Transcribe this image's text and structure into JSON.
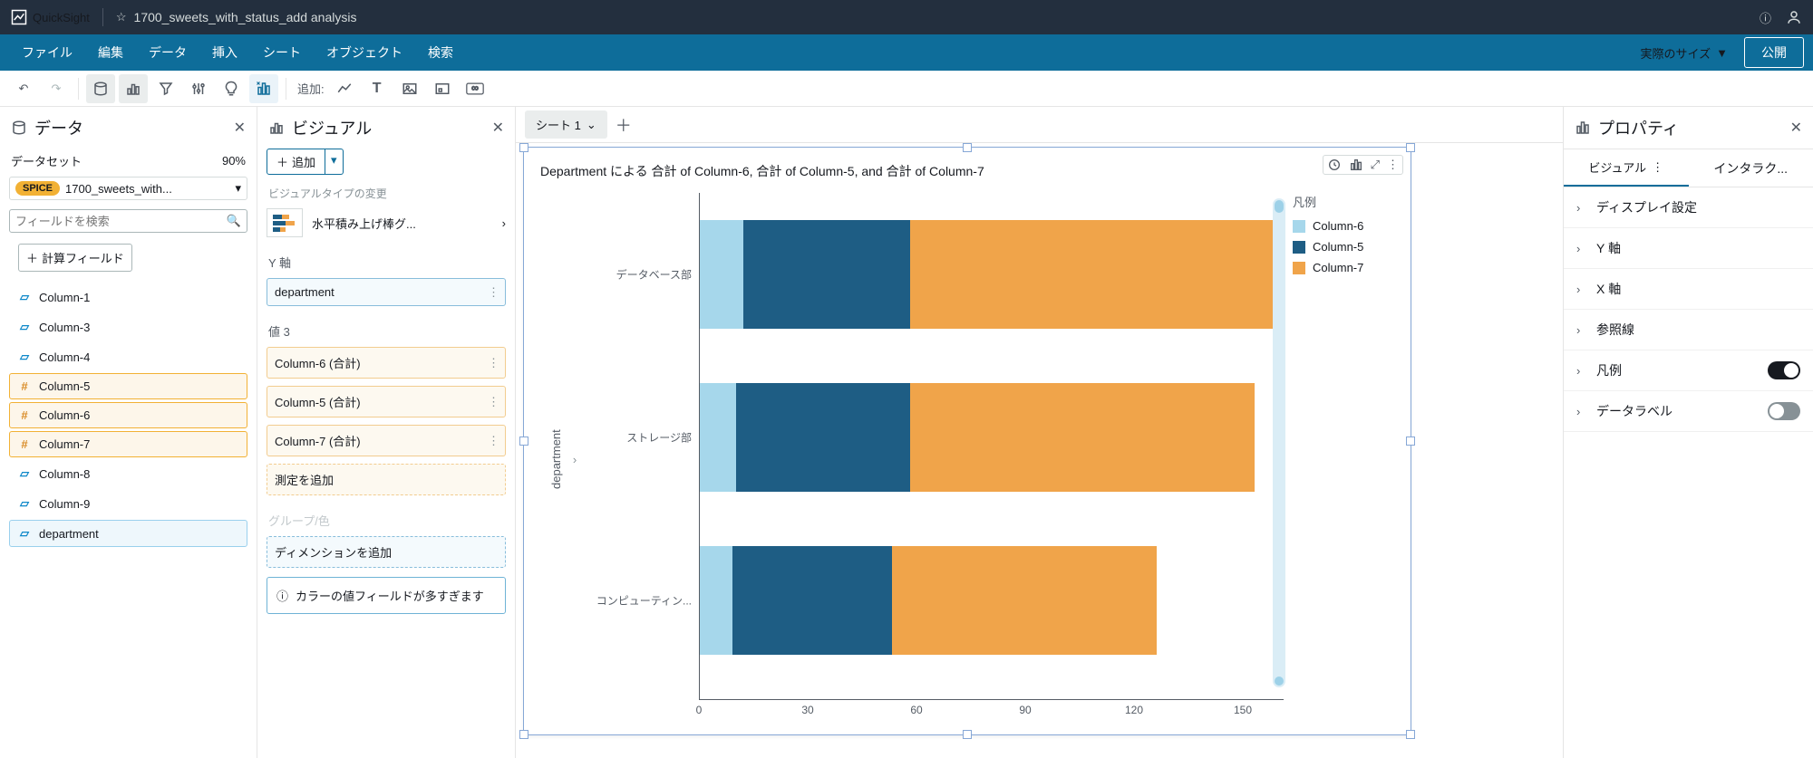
{
  "app": {
    "name": "QuickSight"
  },
  "analysis": {
    "title": "1700_sweets_with_status_add analysis"
  },
  "menubar": {
    "items": [
      "ファイル",
      "編集",
      "データ",
      "挿入",
      "シート",
      "オブジェクト",
      "検索"
    ],
    "size_label": "実際のサイズ",
    "publish": "公開"
  },
  "toolbar": {
    "add_label": "追加:"
  },
  "data_panel": {
    "title": "データ",
    "dataset_label": "データセット",
    "spice_pct": "90%",
    "spice_badge": "SPICE",
    "dataset_name": "1700_sweets_with...",
    "search_placeholder": "フィールドを検索",
    "calc_field": "計算フィールド",
    "fields": [
      {
        "name": "Column-1",
        "type": "text"
      },
      {
        "name": "Column-3",
        "type": "text"
      },
      {
        "name": "Column-4",
        "type": "text"
      },
      {
        "name": "Column-5",
        "type": "num",
        "sel": "measure"
      },
      {
        "name": "Column-6",
        "type": "num",
        "sel": "measure"
      },
      {
        "name": "Column-7",
        "type": "num",
        "sel": "measure"
      },
      {
        "name": "Column-8",
        "type": "text"
      },
      {
        "name": "Column-9",
        "type": "text"
      },
      {
        "name": "department",
        "type": "dept",
        "sel": "dim"
      }
    ]
  },
  "visual_panel": {
    "title": "ビジュアル",
    "add_label": "追加",
    "change_type_label": "ビジュアルタイプの変更",
    "type_name": "水平積み上げ棒グ...",
    "y_axis_label": "Y 軸",
    "y_axis_value": "department",
    "values_label": "値 3",
    "values": [
      "Column-6 (合計)",
      "Column-5 (合計)",
      "Column-7 (合計)"
    ],
    "values_placeholder": "測定を追加",
    "group_label": "グループ/色",
    "group_placeholder": "ディメンションを追加",
    "info_msg": "カラーの値フィールドが多すぎます"
  },
  "sheet": {
    "tab": "シート 1"
  },
  "chart": {
    "title": "Department による 合計 of Column-6, 合計 of Column-5, and 合計 of Column-7",
    "y_axis_title": "department",
    "legend_title": "凡例"
  },
  "chart_data": {
    "type": "bar",
    "orientation": "horizontal-stacked",
    "categories": [
      "データベース部",
      "ストレージ部",
      "コンピューティン..."
    ],
    "xlabel": "",
    "ylabel": "department",
    "xlim": [
      0,
      160
    ],
    "xticks": [
      0,
      30,
      60,
      90,
      120,
      150
    ],
    "series": [
      {
        "name": "Column-6",
        "color": "#a6d7eb",
        "values": [
          12,
          10,
          9
        ]
      },
      {
        "name": "Column-5",
        "color": "#1e5d84",
        "values": [
          46,
          48,
          44
        ]
      },
      {
        "name": "Column-7",
        "color": "#f0a44a",
        "values": [
          100,
          95,
          73
        ]
      }
    ]
  },
  "props": {
    "title": "プロパティ",
    "tabs": [
      "ビジュアル",
      "インタラク..."
    ],
    "rows": [
      {
        "label": "ディスプレイ設定"
      },
      {
        "label": "Y 軸"
      },
      {
        "label": "X 軸"
      },
      {
        "label": "参照線"
      },
      {
        "label": "凡例",
        "toggle": true,
        "on": true
      },
      {
        "label": "データラベル",
        "toggle": true,
        "on": false
      }
    ]
  }
}
